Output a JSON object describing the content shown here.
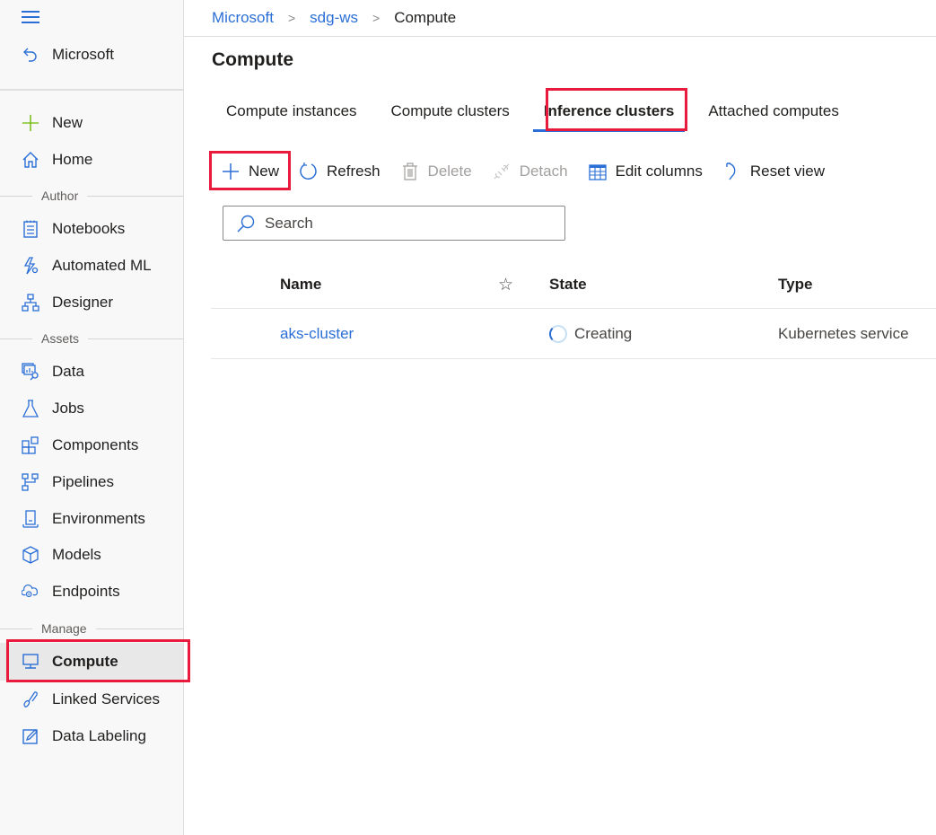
{
  "sidebar": {
    "back_label": "Microsoft",
    "sections": {
      "author": "Author",
      "assets": "Assets",
      "manage": "Manage"
    },
    "items": {
      "new": "New",
      "home": "Home",
      "notebooks": "Notebooks",
      "automated_ml": "Automated ML",
      "designer": "Designer",
      "data": "Data",
      "jobs": "Jobs",
      "components": "Components",
      "pipelines": "Pipelines",
      "environments": "Environments",
      "models": "Models",
      "endpoints": "Endpoints",
      "compute": "Compute",
      "linked_services": "Linked Services",
      "data_labeling": "Data Labeling"
    },
    "selected": "Compute"
  },
  "breadcrumb": [
    "Microsoft",
    "sdg-ws",
    "Compute"
  ],
  "page_title": "Compute",
  "tabs": [
    {
      "label": "Compute instances",
      "active": false
    },
    {
      "label": "Compute clusters",
      "active": false
    },
    {
      "label": "Inference clusters",
      "active": true
    },
    {
      "label": "Attached computes",
      "active": false
    }
  ],
  "toolbar": {
    "new": "New",
    "refresh": "Refresh",
    "delete": "Delete",
    "detach": "Detach",
    "edit_columns": "Edit columns",
    "reset_view": "Reset view"
  },
  "search": {
    "placeholder": "Search",
    "value": ""
  },
  "table": {
    "columns": {
      "name": "Name",
      "state": "State",
      "type": "Type"
    },
    "rows": [
      {
        "name": "aks-cluster",
        "state": "Creating",
        "type": "Kubernetes service"
      }
    ]
  },
  "colors": {
    "accent": "#2b6fd6",
    "highlight": "#e81b3d",
    "new_icon": "#6bb700"
  }
}
